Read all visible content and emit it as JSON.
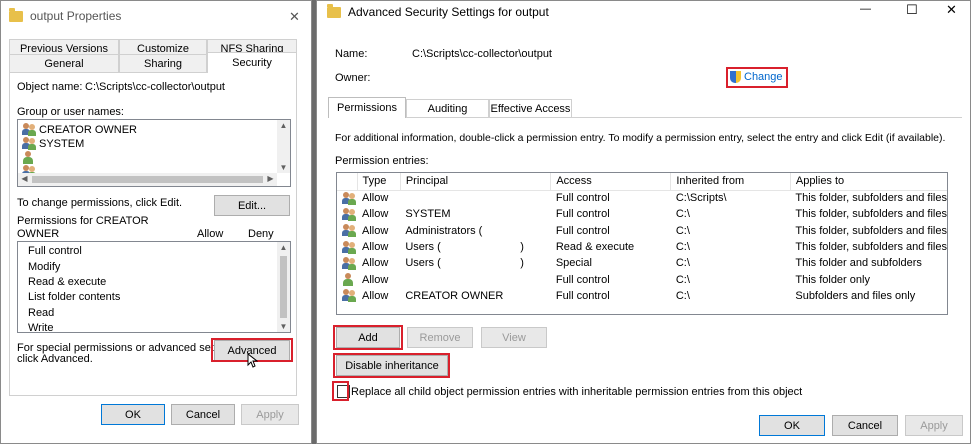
{
  "left_window": {
    "title": "output Properties",
    "close_glyph": "✕",
    "tabs_row1": [
      "Previous Versions",
      "Customize",
      "NFS Sharing"
    ],
    "tabs_row2": [
      "General",
      "Sharing",
      "Security"
    ],
    "object_name_label": "Object name:",
    "object_name_value": "C:\\Scripts\\cc-collector\\output",
    "group_label": "Group or user names:",
    "groups": [
      "CREATOR OWNER",
      "SYSTEM",
      "",
      ""
    ],
    "change_perm_text": "To change permissions, click Edit.",
    "edit_label": "Edit...",
    "perm_for_label_1": "Permissions for CREATOR",
    "perm_for_label_2": "OWNER",
    "allow_header": "Allow",
    "deny_header": "Deny",
    "permissions": [
      "Full control",
      "Modify",
      "Read & execute",
      "List folder contents",
      "Read",
      "Write"
    ],
    "special_text_1": "For special permissions or advanced settings,",
    "special_text_2": "click Advanced.",
    "advanced_label": "Advanced",
    "ok_label": "OK",
    "cancel_label": "Cancel",
    "apply_label": "Apply"
  },
  "right_window": {
    "title": "Advanced Security Settings for output",
    "minimize_glyph": "—",
    "maximize_glyph": "☐",
    "close_glyph": "✕",
    "name_label": "Name:",
    "name_value": "C:\\Scripts\\cc-collector\\output",
    "owner_label": "Owner:",
    "change_label": "Change",
    "tabs": [
      "Permissions",
      "Auditing",
      "Effective Access"
    ],
    "info_text": "For additional information, double-click a permission entry. To modify a permission entry, select the entry and click Edit (if available).",
    "entries_label": "Permission entries:",
    "columns": [
      "Type",
      "Principal",
      "Access",
      "Inherited from",
      "Applies to"
    ],
    "rows": [
      {
        "icon": "group",
        "type": "Allow",
        "principal": "",
        "access": "Full control",
        "inherited": "C:\\Scripts\\",
        "applies": "This folder, subfolders and files"
      },
      {
        "icon": "group",
        "type": "Allow",
        "principal": "SYSTEM",
        "access": "Full control",
        "inherited": "C:\\",
        "applies": "This folder, subfolders and files"
      },
      {
        "icon": "group",
        "type": "Allow",
        "principal": "Administrators (",
        "access": "Full control",
        "inherited": "C:\\",
        "applies": "This folder, subfolders and files"
      },
      {
        "icon": "group",
        "type": "Allow",
        "principal": "Users (                          )",
        "access": "Read & execute",
        "inherited": "C:\\",
        "applies": "This folder, subfolders and files"
      },
      {
        "icon": "group",
        "type": "Allow",
        "principal": "Users (                          )",
        "access": "Special",
        "inherited": "C:\\",
        "applies": "This folder and subfolders"
      },
      {
        "icon": "user",
        "type": "Allow",
        "principal": "",
        "access": "Full control",
        "inherited": "C:\\",
        "applies": "This folder only"
      },
      {
        "icon": "group",
        "type": "Allow",
        "principal": "CREATOR OWNER",
        "access": "Full control",
        "inherited": "C:\\",
        "applies": "Subfolders and files only"
      }
    ],
    "add_label": "Add",
    "remove_label": "Remove",
    "view_label": "View",
    "disable_inheritance_label": "Disable inheritance",
    "replace_label": "Replace all child object permission entries with inheritable permission entries from this object",
    "ok_label": "OK",
    "cancel_label": "Cancel",
    "apply_label": "Apply"
  },
  "colors": {
    "highlight": "#d9202c",
    "link": "#0066cc",
    "background": "#6b6b6b"
  }
}
